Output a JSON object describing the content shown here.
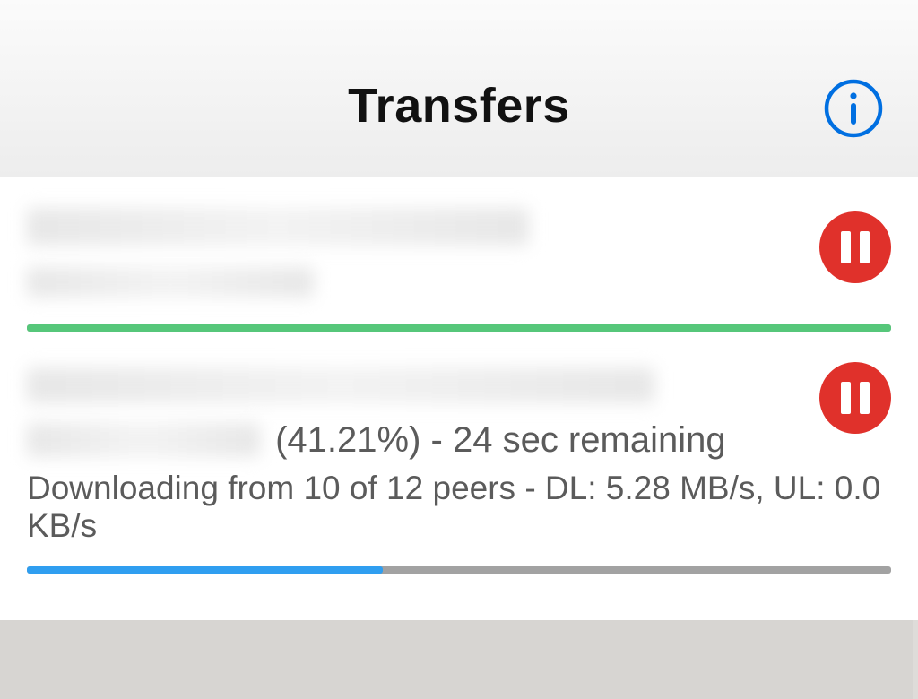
{
  "header": {
    "title": "Transfers"
  },
  "icons": {
    "info": "info-icon",
    "pause": "pause-icon"
  },
  "colors": {
    "accent": "#006fe1",
    "pause_button": "#e0312b",
    "progress_complete": "#56c77a",
    "progress_active": "#2f9ef0",
    "progress_track": "#a2a2a2"
  },
  "transfers": [
    {
      "name_redacted": true,
      "status_line": "",
      "peers_line": "",
      "progress_pct": 100,
      "progress_state": "complete"
    },
    {
      "name_redacted": true,
      "status_suffix": " (41.21%) - 24 sec remaining",
      "peers_line": "Downloading from 10 of 12 peers - DL: 5.28 MB/s, UL: 0.0 KB/s",
      "progress_pct": 41.21,
      "progress_state": "active"
    }
  ]
}
